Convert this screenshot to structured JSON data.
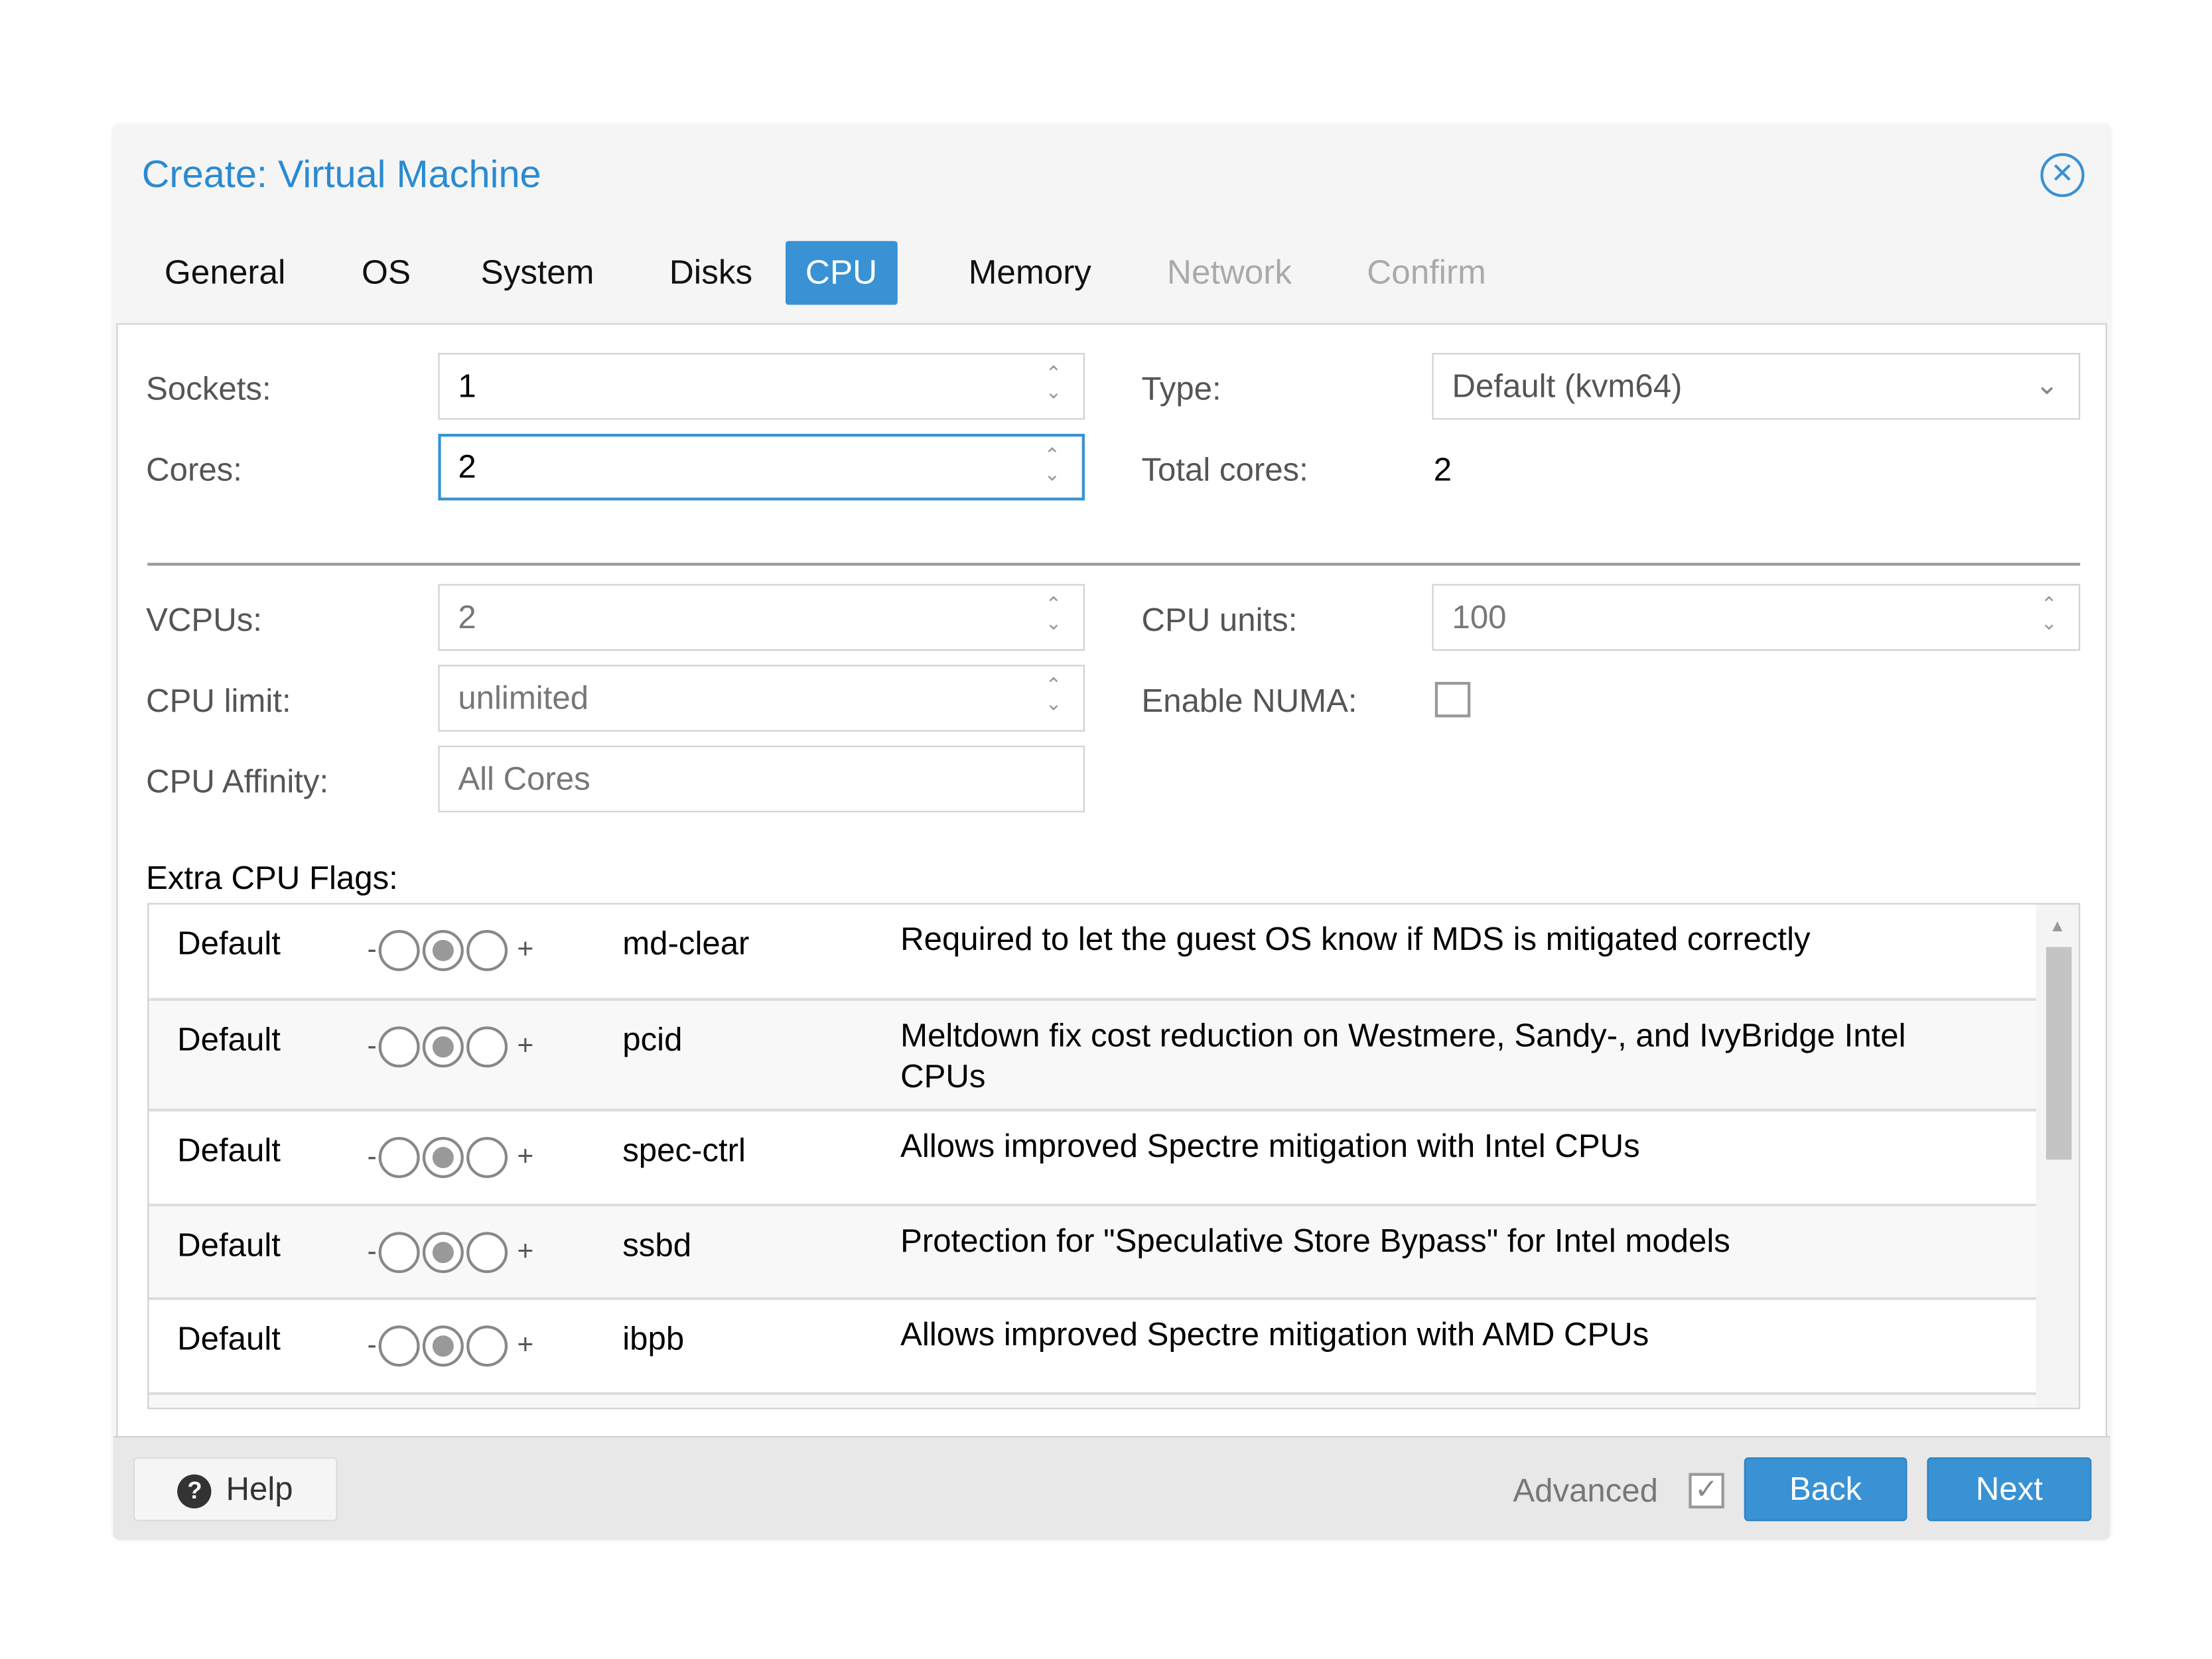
{
  "dialog": {
    "title": "Create: Virtual Machine",
    "close_icon": "close-circle-icon"
  },
  "tabs": [
    {
      "label": "General",
      "state": "normal"
    },
    {
      "label": "OS",
      "state": "normal"
    },
    {
      "label": "System",
      "state": "normal"
    },
    {
      "label": "Disks",
      "state": "normal"
    },
    {
      "label": "CPU",
      "state": "active"
    },
    {
      "label": "Memory",
      "state": "normal"
    },
    {
      "label": "Network",
      "state": "disabled"
    },
    {
      "label": "Confirm",
      "state": "disabled"
    }
  ],
  "form": {
    "sockets": {
      "label": "Sockets:",
      "value": "1"
    },
    "cores": {
      "label": "Cores:",
      "value": "2"
    },
    "type": {
      "label": "Type:",
      "value": "Default (kvm64)"
    },
    "total_cores": {
      "label": "Total cores:",
      "value": "2"
    },
    "vcpus": {
      "label": "VCPUs:",
      "value": "2"
    },
    "cpu_units": {
      "label": "CPU units:",
      "value": "100"
    },
    "cpu_limit": {
      "label": "CPU limit:",
      "value": "unlimited"
    },
    "enable_numa": {
      "label": "Enable NUMA:",
      "checked": false
    },
    "cpu_affinity": {
      "label": "CPU Affinity:",
      "value": "All Cores"
    }
  },
  "flags": {
    "label": "Extra CPU Flags:",
    "rows": [
      {
        "state": "Default",
        "minus": "-",
        "plus": "+",
        "flag": "md-clear",
        "desc": "Required to let the guest OS know if MDS is mitigated correctly"
      },
      {
        "state": "Default",
        "minus": "-",
        "plus": "+",
        "flag": "pcid",
        "desc": "Meltdown fix cost reduction on Westmere, Sandy-, and IvyBridge Intel CPUs"
      },
      {
        "state": "Default",
        "minus": "-",
        "plus": "+",
        "flag": "spec-ctrl",
        "desc": "Allows improved Spectre mitigation with Intel CPUs"
      },
      {
        "state": "Default",
        "minus": "-",
        "plus": "+",
        "flag": "ssbd",
        "desc": "Protection for \"Speculative Store Bypass\" for Intel models"
      },
      {
        "state": "Default",
        "minus": "-",
        "plus": "+",
        "flag": "ibpb",
        "desc": "Allows improved Spectre mitigation with AMD CPUs"
      }
    ]
  },
  "footer": {
    "help": "Help",
    "advanced": "Advanced",
    "advanced_checked": true,
    "back": "Back",
    "next": "Next"
  },
  "colors": {
    "accent": "#3892d4"
  }
}
